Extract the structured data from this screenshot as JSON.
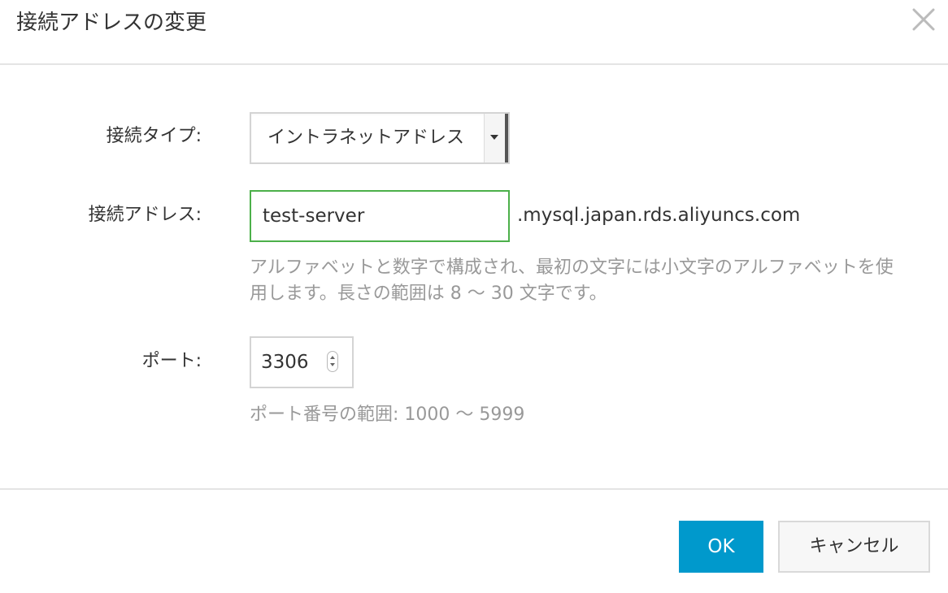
{
  "dialog": {
    "title": "接続アドレスの変更",
    "close_icon": "close-icon"
  },
  "form": {
    "connection_type": {
      "label": "接続タイプ:",
      "selected_value": "イントラネットアドレス"
    },
    "connection_address": {
      "label": "接続アドレス:",
      "value": "test-server",
      "suffix": ".mysql.japan.rds.aliyuncs.com",
      "help_line1": "アルファベットと数字で構成され、最初の文字には小文字のアルファベットを使",
      "help_line2": "用します。長さの範囲は 8 〜 30 文字です。"
    },
    "port": {
      "label": "ポート:",
      "value": "3306",
      "help": "ポート番号の範囲: 1000 〜 5999"
    }
  },
  "footer": {
    "ok_label": "OK",
    "cancel_label": "キャンセル"
  },
  "colors": {
    "primary_button": "#0099cc",
    "input_focus_border": "#4cb04a",
    "help_text": "#999999"
  }
}
